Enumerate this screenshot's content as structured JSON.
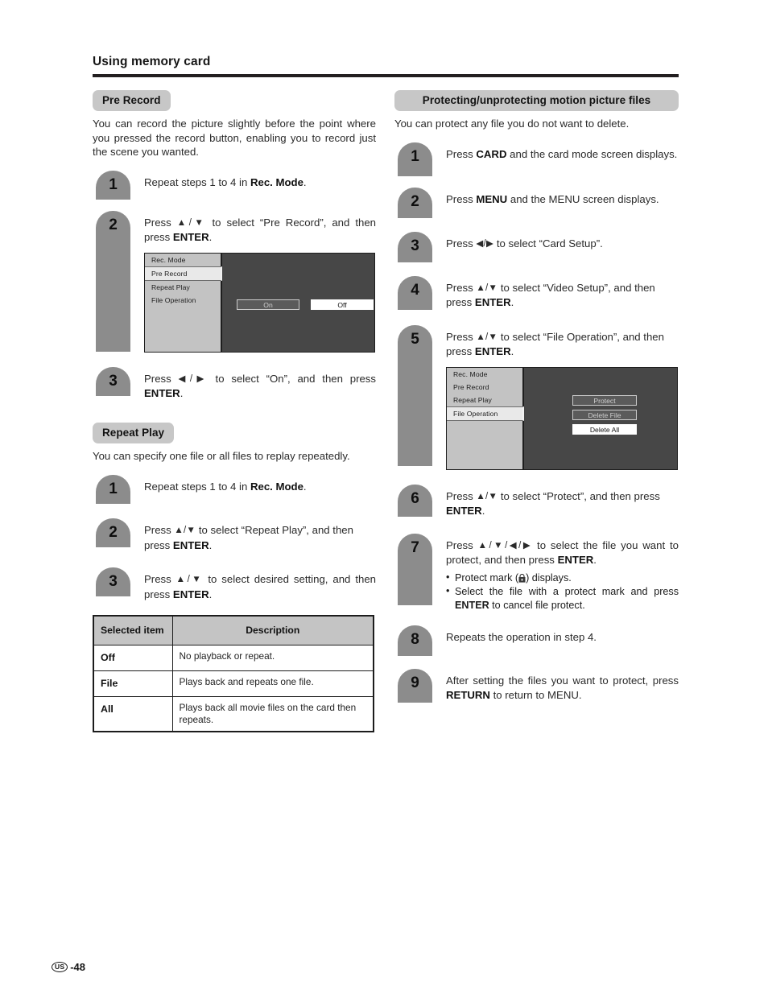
{
  "header": {
    "title": "Using memory card"
  },
  "left_column": {
    "pre_record": {
      "heading": "Pre Record",
      "intro": "You can record the picture slightly before the point where you pressed the record button, enabling you to record just the scene you wanted.",
      "steps": [
        {
          "number": "1",
          "text_html": "Repeat steps 1 to 4 in <b>Rec. Mode</b>."
        },
        {
          "number": "2",
          "text_html": "Press <span class=\"keys\">▲/▼</span> to select “Pre Record”, and then press <b>ENTER</b>."
        },
        {
          "number": "3",
          "text_html": "Press <span class=\"keys\">◀/▶</span> to select “On”, and then press <b>ENTER</b>."
        }
      ],
      "menu_shot": {
        "items": [
          "Rec. Mode",
          "Pre Record",
          "Repeat Play",
          "File Operation"
        ],
        "selected_item": "Pre Record",
        "options": [
          "On",
          "Off"
        ],
        "highlighted_option": "Off"
      }
    },
    "repeat_play": {
      "heading": "Repeat Play",
      "intro": "You can specify one file or all files to replay repeatedly.",
      "steps": [
        {
          "number": "1",
          "text_html": "Repeat steps 1 to 4 in <b>Rec. Mode</b>."
        },
        {
          "number": "2",
          "text_html": "Press <span class=\"keys\">▲/▼</span> to select “Repeat Play”, and then press <b>ENTER</b>."
        },
        {
          "number": "3",
          "text_html": "Press <span class=\"keys\">▲/▼</span> to select desired setting, and then press <b>ENTER</b>."
        }
      ],
      "table": {
        "headers": [
          "Selected item",
          "Description"
        ],
        "rows": [
          {
            "item": "Off",
            "description": "No playback or repeat."
          },
          {
            "item": "File",
            "description": "Plays back and repeats one file."
          },
          {
            "item": "All",
            "description": "Plays back all movie files on the card then repeats."
          }
        ]
      }
    }
  },
  "right_column": {
    "protecting": {
      "heading": "Protecting/unprotecting motion picture files",
      "intro": "You can protect any file you do not want to delete.",
      "steps": [
        {
          "number": "1",
          "text_html": "Press <b>CARD</b> and the card mode screen displays."
        },
        {
          "number": "2",
          "text_html": "Press <b>MENU</b> and the MENU screen displays."
        },
        {
          "number": "3",
          "text_html": "Press <span class=\"keys\">◀/▶</span> to select “Card Setup”."
        },
        {
          "number": "4",
          "text_html": "Press <span class=\"keys\">▲/▼</span> to select “Video Setup”, and then press <b>ENTER</b>."
        },
        {
          "number": "5",
          "text_html": "Press <span class=\"keys\">▲/▼</span> to select “File Operation”, and then press <b>ENTER</b>."
        },
        {
          "number": "6",
          "text_html": "Press <span class=\"keys\">▲/▼</span> to select “Protect”, and then press <b>ENTER</b>."
        },
        {
          "number": "7",
          "text_html": "Press <span class=\"keys\">▲/▼/◀/▶</span> to select the file you want to protect, and then press <b>ENTER</b>."
        },
        {
          "number": "8",
          "text_html": "Repeats the operation in step 4."
        },
        {
          "number": "9",
          "text_html": "After setting the files you want to protect, press <b>RETURN</b> to return to MENU."
        }
      ],
      "step7_bullets": [
        "Protect mark ( ) displays.",
        "Select the file with a protect mark and press ENTER to cancel file protect."
      ],
      "menu_shot": {
        "items": [
          "Rec. Mode",
          "Pre Record",
          "Repeat Play",
          "File Operation"
        ],
        "selected_item": "File Operation",
        "options": [
          "Protect",
          "Delete File",
          "Delete All"
        ],
        "highlighted_option": "Delete All"
      }
    }
  },
  "footer": {
    "region_mark": "US",
    "page_number": "-48"
  },
  "colors": {
    "pill_gray": "#c7c7c7",
    "badge_gray": "#8c8c8c",
    "rule_black": "#231f20",
    "menu_panel_gray": "#c3c3c3",
    "menu_bg_dark": "#474747",
    "table_header_gray": "#c4c4c4"
  }
}
